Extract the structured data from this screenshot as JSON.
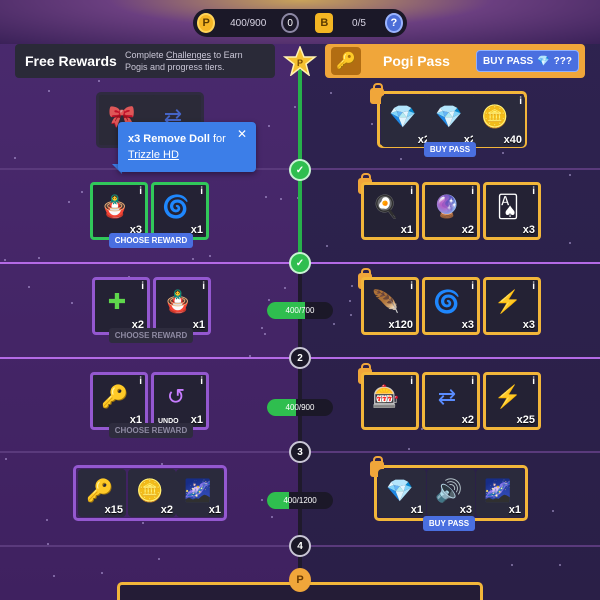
{
  "topbar": {
    "pogi_icon": "P",
    "pogi_progress": "400/900",
    "token_count": "0",
    "badge_icon": "B",
    "badge_progress": "0/5",
    "help_icon": "?"
  },
  "free": {
    "title": "Free Rewards",
    "desc_line1_pre": "Complete ",
    "desc_line1_link": "Challenges",
    "desc_line1_post": " to Earn",
    "desc_line2": "Pogis and progress tiers."
  },
  "pass": {
    "title": "Pogi Pass",
    "buy_label": "BUY PASS",
    "buy_price": "???",
    "buy_pass_label": "BUY PASS"
  },
  "tooltip": {
    "title": "x3 Remove Doll",
    "for_text": " for",
    "game": "Trizzle HD",
    "close": "✕"
  },
  "rows": [
    {
      "free_cards": [
        {
          "art": "🎀",
          "qty": ""
        },
        {
          "art": "⇄",
          "qty": ""
        }
      ],
      "pass_cards": [
        {
          "art": "💎",
          "qty": "x2",
          "info": "i"
        },
        {
          "art": "💎",
          "qty": "x2",
          "info": "i"
        },
        {
          "art": "🪙",
          "qty": "x40",
          "info": "i"
        }
      ]
    },
    {
      "free_cards": [
        {
          "art": "🪆",
          "qty": "x3",
          "info": "i"
        },
        {
          "art": "🌀",
          "qty": "x1",
          "info": "i"
        }
      ],
      "choose": "CHOOSE REWARD",
      "pass_cards": [
        {
          "art": "🍳",
          "qty": "x1",
          "info": "i"
        },
        {
          "art": "🔮",
          "qty": "x2",
          "info": "i"
        },
        {
          "art": "🂡",
          "qty": "x3",
          "info": "i"
        }
      ]
    },
    {
      "free_cards": [
        {
          "art": "✚",
          "qty": "x2",
          "info": "i"
        },
        {
          "art": "🪆",
          "qty": "x1",
          "info": "i"
        }
      ],
      "choose": "CHOOSE REWARD",
      "progress": "400/700",
      "pass_cards": [
        {
          "art": "🪶",
          "qty": "x120",
          "info": "i"
        },
        {
          "art": "🌀",
          "qty": "x3",
          "info": "i"
        },
        {
          "art": "⚡",
          "qty": "x3",
          "info": "i"
        }
      ]
    },
    {
      "free_cards": [
        {
          "art": "🔑",
          "qty": "x1",
          "info": "i"
        },
        {
          "art": "↺",
          "qty": "x1",
          "info": "i",
          "sub": "UNDO"
        }
      ],
      "choose": "CHOOSE REWARD",
      "progress": "400/900",
      "pass_cards": [
        {
          "art": "🎰",
          "qty": "",
          "info": "i"
        },
        {
          "art": "⇄",
          "qty": "x2",
          "info": "i"
        },
        {
          "art": "⚡",
          "qty": "x25",
          "info": "i"
        }
      ]
    },
    {
      "free_cards": [
        {
          "art": "🔑",
          "qty": "x15",
          "info": ""
        },
        {
          "art": "🪙",
          "qty": "x2",
          "info": ""
        },
        {
          "art": "🌌",
          "qty": "x1",
          "info": ""
        }
      ],
      "progress": "400/1200",
      "pass_cards": [
        {
          "art": "💎",
          "qty": "x1",
          "info": ""
        },
        {
          "art": "🔊",
          "qty": "x3",
          "info": ""
        },
        {
          "art": "🌌",
          "qty": "x1",
          "info": ""
        }
      ],
      "buy_pass": "BUY PASS"
    }
  ],
  "nodes": {
    "n2": "2",
    "n3": "3",
    "n4": "4",
    "check": "✓"
  },
  "progress_fractions": {
    "p1": 0.571,
    "p2": 0.444,
    "p3": 0.333
  },
  "colors": {
    "gold": "#f2b63a",
    "green": "#31c85a",
    "purple": "#9458d0",
    "blue": "#4a6fe0"
  }
}
